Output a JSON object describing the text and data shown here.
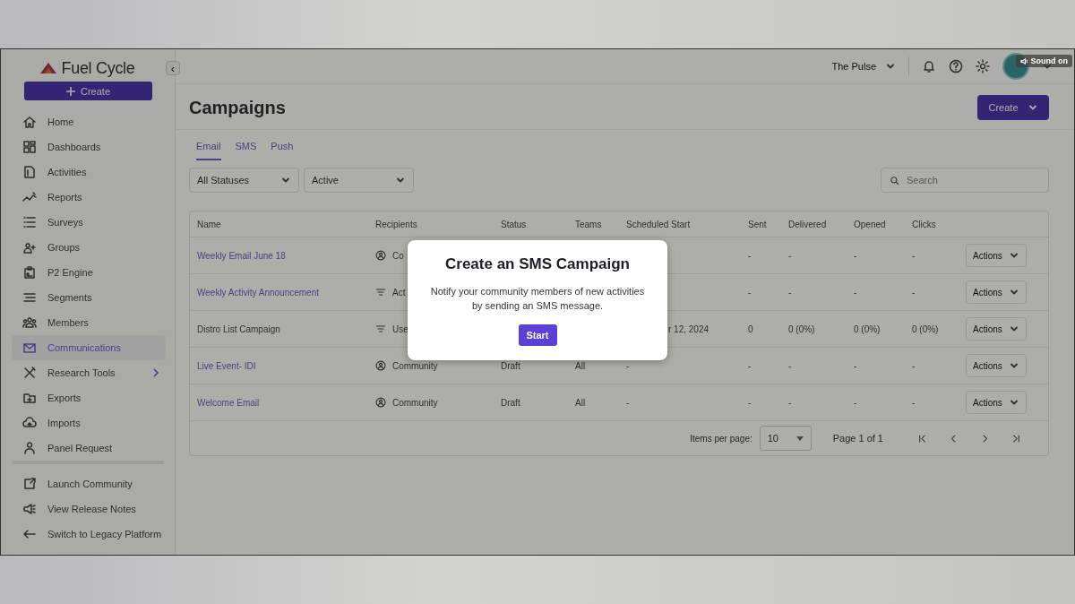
{
  "sidebar": {
    "logo": "Fuel Cycle",
    "create_button": "Create",
    "collapse_button": "‹",
    "items": [
      {
        "label": "Home",
        "selected": false
      },
      {
        "label": "Dashboards",
        "selected": false
      },
      {
        "label": "Activities",
        "selected": false
      },
      {
        "label": "Reports",
        "selected": false
      },
      {
        "label": "Surveys",
        "selected": false
      },
      {
        "label": "Groups",
        "selected": false
      },
      {
        "label": "P2 Engine",
        "selected": false
      },
      {
        "label": "Segments",
        "selected": false
      },
      {
        "label": "Members",
        "selected": false
      },
      {
        "label": "Communications",
        "selected": true
      },
      {
        "label": "Research Tools",
        "selected": false,
        "expandable": true
      },
      {
        "label": "Exports",
        "selected": false
      },
      {
        "label": "Imports",
        "selected": false
      },
      {
        "label": "Panel Request",
        "selected": false
      }
    ],
    "footer_items": [
      {
        "label": "Launch Community"
      },
      {
        "label": "View Release Notes"
      },
      {
        "label": "Switch to Legacy Platform"
      }
    ]
  },
  "topbar": {
    "community": "The Pulse",
    "sound_badge": "Sound on"
  },
  "page": {
    "title": "Campaigns",
    "create_button": "Create",
    "tabs": [
      {
        "label": "Email",
        "selected": true
      },
      {
        "label": "SMS",
        "selected": false
      },
      {
        "label": "Push",
        "selected": false
      }
    ],
    "filters": [
      {
        "value": "All Statuses"
      },
      {
        "value": "Active"
      }
    ],
    "search": {
      "placeholder": "Search"
    }
  },
  "table": {
    "columns": [
      "Name",
      "Recipients",
      "Status",
      "Teams",
      "Scheduled Start",
      "Sent",
      "Delivered",
      "Opened",
      "Clicks"
    ],
    "rows": [
      {
        "name": "Weekly Email June 18",
        "link": true,
        "kind": "community",
        "recipients": "Co",
        "status": null,
        "teams": null,
        "scheduled": null,
        "sent": "-",
        "delivered": "-",
        "opened": "-",
        "clicks": "-",
        "action": "Actions"
      },
      {
        "name": "Weekly Activity Announcement",
        "link": true,
        "kind": "list",
        "recipients": "Act",
        "status": null,
        "teams": null,
        "scheduled": null,
        "sent": "-",
        "delivered": "-",
        "opened": "-",
        "clicks": "-",
        "action": "Actions"
      },
      {
        "name": "Distro List Campaign",
        "link": false,
        "kind": "list",
        "recipients": "Use",
        "status": null,
        "teams": null,
        "scheduled": "r 12, 2024",
        "scheduled_covered_left": true,
        "sent": "0",
        "delivered": "0 (0%)",
        "opened": "0 (0%)",
        "clicks": "0 (0%)",
        "action": "Actions"
      },
      {
        "name": "Live Event- IDI",
        "link": true,
        "kind": "community",
        "recipients": "Community",
        "status": "Draft",
        "teams": "All",
        "scheduled": "-",
        "sent": "-",
        "delivered": "-",
        "opened": "-",
        "clicks": "-",
        "action": "Actions"
      },
      {
        "name": "Welcome Email",
        "link": true,
        "kind": "community",
        "recipients": "Community",
        "status": "Draft",
        "teams": "All",
        "scheduled": "-",
        "sent": "-",
        "delivered": "-",
        "opened": "-",
        "clicks": "-",
        "action": "Actions"
      }
    ],
    "pagination": {
      "items_label": "Items per page:",
      "page_size": "10",
      "page_info": "Page 1 of 1"
    }
  },
  "modal": {
    "title": "Create an SMS Campaign",
    "body": "Notify your community members of new activities by sending an SMS message.",
    "button": "Start"
  }
}
